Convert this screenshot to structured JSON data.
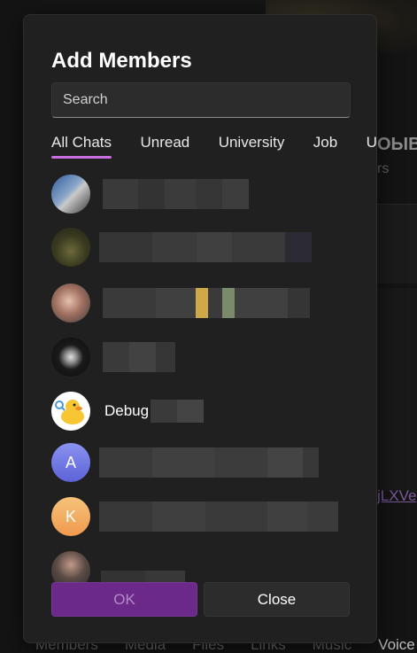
{
  "dialog": {
    "title": "Add Members",
    "search_placeholder": "Search",
    "tabs": [
      {
        "label": "All Chats",
        "active": true
      },
      {
        "label": "Unread",
        "active": false
      },
      {
        "label": "University",
        "active": false
      },
      {
        "label": "Job",
        "active": false
      },
      {
        "label": "Unread",
        "active": false
      }
    ],
    "members": [
      {
        "initial": "",
        "name": "",
        "avatar_color": "#5a6b8c"
      },
      {
        "initial": "",
        "name": "",
        "avatar_color": "#3d4a2c"
      },
      {
        "initial": "",
        "name": "",
        "avatar_color": "#8a6a5a"
      },
      {
        "initial": "",
        "name": "",
        "avatar_color": "#181818"
      },
      {
        "initial": "",
        "name": "Debug",
        "avatar_color": "#ffffff"
      },
      {
        "initial": "A",
        "name": "",
        "avatar_color": "#6f77e6"
      },
      {
        "initial": "K",
        "name": "",
        "avatar_color": "#f2a35a"
      },
      {
        "initial": "",
        "name": "",
        "avatar_color": "#4a4040"
      }
    ],
    "ok_label": "OK",
    "close_label": "Close",
    "accent_color": "#c76fe0"
  },
  "background": {
    "title_fragment": "ОЫВ",
    "subtitle_fragment": "rs",
    "link_fragment": "jLXVe",
    "tabs": [
      "Members",
      "Media",
      "Files",
      "Links",
      "Music",
      "Voice"
    ]
  }
}
